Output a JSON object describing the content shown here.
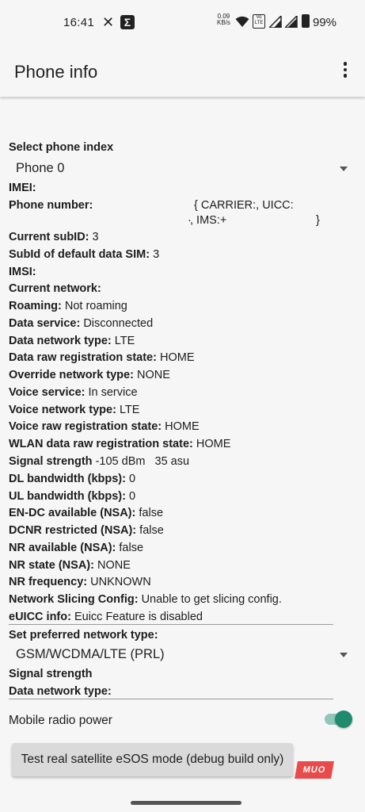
{
  "status_bar": {
    "time": "16:41",
    "x_glyph": "✕",
    "sigma_glyph": "Σ",
    "speed_value": "0.09",
    "speed_unit": "KB/s",
    "volte_top": "Vo",
    "volte_bottom": "LTE",
    "battery": "99%",
    "icons": [
      "x-icon",
      "sigma-icon",
      "wifi-icon",
      "volte-icon",
      "cell-signal-icon",
      "cell-signal-icon",
      "battery-icon"
    ]
  },
  "app_bar": {
    "title": "Phone info",
    "overflow_icon": "more-vertical-icon"
  },
  "phone_index": {
    "label": "Select phone index",
    "value": "Phone 0"
  },
  "info": {
    "imei_label": "IMEI:",
    "phone_number_label": "Phone number:",
    "phone_number_line1": "{ CARRIER:, UICC:",
    "phone_number_line2_start": "·",
    "phone_number_line2": ", IMS:+",
    "phone_number_line2_end": "}",
    "current_subid_label": "Current subID:",
    "current_subid_value": "3",
    "default_data_label": "SubId of default data SIM:",
    "default_data_value": "3",
    "imsi_label": "IMSI:",
    "current_network_label": "Current network:",
    "roaming_label": "Roaming:",
    "roaming_value": "Not roaming",
    "data_service_label": "Data service:",
    "data_service_value": "Disconnected",
    "data_network_type_label": "Data network type:",
    "data_network_type_value": "LTE",
    "data_raw_reg_label": "Data raw registration state:",
    "data_raw_reg_value": "HOME",
    "override_network_label": "Override network type:",
    "override_network_value": "NONE",
    "voice_service_label": "Voice service:",
    "voice_service_value": "In service",
    "voice_network_type_label": "Voice network type:",
    "voice_network_type_value": "LTE",
    "voice_raw_reg_label": "Voice raw registration state:",
    "voice_raw_reg_value": "HOME",
    "wlan_raw_reg_label": "WLAN data raw registration state:",
    "wlan_raw_reg_value": "HOME",
    "signal_strength_label": "Signal strength",
    "signal_strength_value": "-105 dBm   35 asu",
    "dl_bandwidth_label": "DL bandwidth (kbps):",
    "dl_bandwidth_value": "0",
    "ul_bandwidth_label": "UL bandwidth (kbps):",
    "ul_bandwidth_value": "0",
    "endc_label": "EN-DC available (NSA):",
    "endc_value": "false",
    "dcnr_label": "DCNR restricted (NSA):",
    "dcnr_value": "false",
    "nr_available_label": "NR available (NSA):",
    "nr_available_value": "false",
    "nr_state_label": "NR state (NSA):",
    "nr_state_value": "NONE",
    "nr_frequency_label": "NR frequency:",
    "nr_frequency_value": "UNKNOWN",
    "slicing_label": "Network Slicing Config:",
    "slicing_value": "Unable to get slicing config.",
    "euicc_label": "eUICC info:",
    "euicc_value": "Euicc Feature is disabled"
  },
  "preferred_network": {
    "label": "Set preferred network type:",
    "value": "GSM/WCDMA/LTE (PRL)"
  },
  "lower": {
    "signal_strength_label": "Signal strength",
    "data_network_type_label": "Data network type:",
    "mobile_radio_label": "Mobile radio power",
    "mobile_radio_on": true,
    "toggle_color": "#1f8a6e"
  },
  "satellite_button": "Test real satellite eSOS mode (debug build only)",
  "watermark": "MUO"
}
